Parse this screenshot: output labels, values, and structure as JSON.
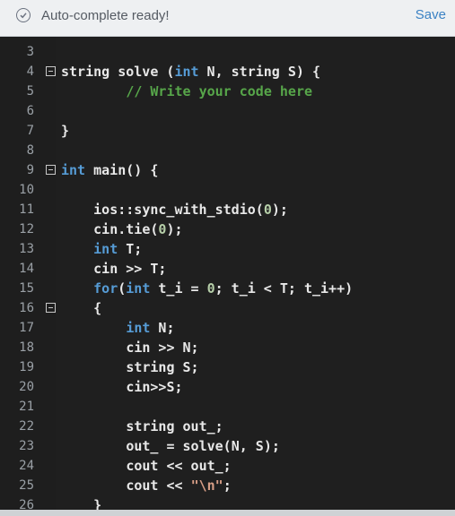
{
  "header": {
    "status_text": "Auto-complete ready!",
    "save_label": "Save",
    "status_icon": "check-circle-icon",
    "accent_color": "#3b82c4"
  },
  "editor": {
    "colors": {
      "kw": "#569cd6",
      "id": "#e8e8e8",
      "cm": "#57a64a",
      "num": "#b5cea8",
      "str": "#d69d85"
    },
    "lines": [
      {
        "n": "3",
        "fold": false,
        "indent": 0,
        "tokens": []
      },
      {
        "n": "4",
        "fold": true,
        "indent": 0,
        "tokens": [
          {
            "t": "string solve (",
            "c": "id"
          },
          {
            "t": "int",
            "c": "kw"
          },
          {
            "t": " N, string S) {",
            "c": "id"
          }
        ]
      },
      {
        "n": "5",
        "fold": false,
        "indent": 8,
        "tokens": [
          {
            "t": "// Write your code here",
            "c": "cm"
          }
        ]
      },
      {
        "n": "6",
        "fold": false,
        "indent": 0,
        "tokens": []
      },
      {
        "n": "7",
        "fold": false,
        "indent": 0,
        "tokens": [
          {
            "t": "}",
            "c": "id"
          }
        ]
      },
      {
        "n": "8",
        "fold": false,
        "indent": 0,
        "tokens": []
      },
      {
        "n": "9",
        "fold": true,
        "indent": 0,
        "tokens": [
          {
            "t": "int",
            "c": "kw"
          },
          {
            "t": " main() {",
            "c": "id"
          }
        ]
      },
      {
        "n": "10",
        "fold": false,
        "indent": 0,
        "tokens": []
      },
      {
        "n": "11",
        "fold": false,
        "indent": 4,
        "tokens": [
          {
            "t": "ios::sync_with_stdio(",
            "c": "id"
          },
          {
            "t": "0",
            "c": "num"
          },
          {
            "t": ");",
            "c": "id"
          }
        ]
      },
      {
        "n": "12",
        "fold": false,
        "indent": 4,
        "tokens": [
          {
            "t": "cin.tie(",
            "c": "id"
          },
          {
            "t": "0",
            "c": "num"
          },
          {
            "t": ");",
            "c": "id"
          }
        ]
      },
      {
        "n": "13",
        "fold": false,
        "indent": 4,
        "tokens": [
          {
            "t": "int",
            "c": "kw"
          },
          {
            "t": " T;",
            "c": "id"
          }
        ]
      },
      {
        "n": "14",
        "fold": false,
        "indent": 4,
        "tokens": [
          {
            "t": "cin >> T;",
            "c": "id"
          }
        ]
      },
      {
        "n": "15",
        "fold": false,
        "indent": 4,
        "tokens": [
          {
            "t": "for",
            "c": "kw"
          },
          {
            "t": "(",
            "c": "id"
          },
          {
            "t": "int",
            "c": "kw"
          },
          {
            "t": " t_i = ",
            "c": "id"
          },
          {
            "t": "0",
            "c": "num"
          },
          {
            "t": "; t_i < T; t_i++)",
            "c": "id"
          }
        ]
      },
      {
        "n": "16",
        "fold": true,
        "indent": 4,
        "tokens": [
          {
            "t": "{",
            "c": "id"
          }
        ]
      },
      {
        "n": "17",
        "fold": false,
        "indent": 8,
        "tokens": [
          {
            "t": "int",
            "c": "kw"
          },
          {
            "t": " N;",
            "c": "id"
          }
        ]
      },
      {
        "n": "18",
        "fold": false,
        "indent": 8,
        "tokens": [
          {
            "t": "cin >> N;",
            "c": "id"
          }
        ]
      },
      {
        "n": "19",
        "fold": false,
        "indent": 8,
        "tokens": [
          {
            "t": "string S;",
            "c": "id"
          }
        ]
      },
      {
        "n": "20",
        "fold": false,
        "indent": 8,
        "tokens": [
          {
            "t": "cin>>S;",
            "c": "id"
          }
        ]
      },
      {
        "n": "21",
        "fold": false,
        "indent": 0,
        "tokens": []
      },
      {
        "n": "22",
        "fold": false,
        "indent": 8,
        "tokens": [
          {
            "t": "string out_;",
            "c": "id"
          }
        ]
      },
      {
        "n": "23",
        "fold": false,
        "indent": 8,
        "tokens": [
          {
            "t": "out_ = solve(N, S);",
            "c": "id"
          }
        ]
      },
      {
        "n": "24",
        "fold": false,
        "indent": 8,
        "tokens": [
          {
            "t": "cout << out_;",
            "c": "id"
          }
        ]
      },
      {
        "n": "25",
        "fold": false,
        "indent": 8,
        "tokens": [
          {
            "t": "cout << ",
            "c": "id"
          },
          {
            "t": "\"\\n\"",
            "c": "str"
          },
          {
            "t": ";",
            "c": "id"
          }
        ]
      },
      {
        "n": "26",
        "fold": false,
        "indent": 4,
        "tokens": [
          {
            "t": "}",
            "c": "id"
          }
        ]
      }
    ]
  }
}
